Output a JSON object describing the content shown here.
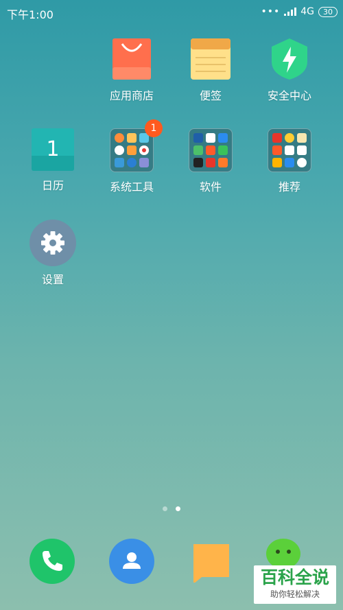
{
  "status_bar": {
    "time": "下午1:00",
    "signal_dots": "•••",
    "network": "4G",
    "battery": "30"
  },
  "apps": [
    {
      "label": "应用商店",
      "icon": "shopping-bag-icon"
    },
    {
      "label": "便签",
      "icon": "notepad-icon"
    },
    {
      "label": "安全中心",
      "icon": "shield-bolt-icon"
    },
    {
      "label": "日历",
      "icon": "calendar-icon",
      "day": "1"
    },
    {
      "label": "系统工具",
      "icon": "folder-icon",
      "badge": "1"
    },
    {
      "label": "软件",
      "icon": "folder-icon"
    },
    {
      "label": "推荐",
      "icon": "folder-icon"
    },
    {
      "label": "设置",
      "icon": "gear-icon"
    }
  ],
  "page_indicator": {
    "total": 2,
    "active": 2
  },
  "dock": [
    "phone-icon",
    "contacts-icon",
    "messages-icon",
    "wechat-icon"
  ],
  "watermark": {
    "title": "百科全说",
    "subtitle": "助你轻松解决"
  },
  "colors": {
    "accent_badge": "#ff5a1f",
    "phone_green": "#1fc46a",
    "contacts_blue": "#3a8fe6",
    "messages_orange": "#ffb44a"
  }
}
